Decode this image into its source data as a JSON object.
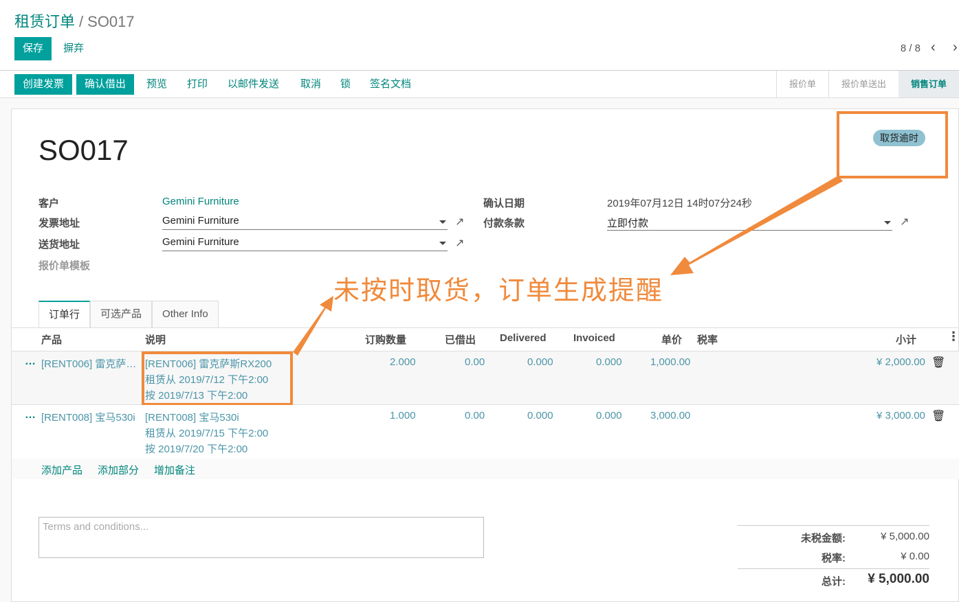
{
  "breadcrumb": {
    "parent": "租赁订单",
    "sep": "/",
    "current": "SO017"
  },
  "actions": {
    "save": "保存",
    "discard": "摒弃"
  },
  "pager": {
    "text": "8 / 8"
  },
  "toolbar": {
    "create_invoice": "创建发票",
    "confirm_checkout": "确认借出",
    "preview": "预览",
    "print": "打印",
    "send_email": "以邮件发送",
    "cancel": "取消",
    "lock": "锁",
    "sign_doc": "签名文档"
  },
  "stages": [
    {
      "label": "报价单"
    },
    {
      "label": "报价单送出"
    },
    {
      "label": "销售订单"
    }
  ],
  "order": {
    "name": "SO017",
    "badge": "取货逾时"
  },
  "fields": {
    "customer_label": "客户",
    "customer": "Gemini Furniture",
    "invoice_addr_label": "发票地址",
    "invoice_addr": "Gemini Furniture",
    "delivery_addr_label": "送货地址",
    "delivery_addr": "Gemini Furniture",
    "template_label": "报价单模板",
    "confirm_date_label": "确认日期",
    "confirm_date": "2019年07月12日 14时07分24秒",
    "payment_terms_label": "付款条款",
    "payment_terms": "立即付款"
  },
  "annotation": "未按时取货，订单生成提醒",
  "tabs": [
    {
      "label": "订单行"
    },
    {
      "label": "可选产品"
    },
    {
      "label": "Other Info"
    }
  ],
  "table": {
    "headers": {
      "product": "产品",
      "desc": "说明",
      "qty": "订购数量",
      "out": "已借出",
      "delivered": "Delivered",
      "invoiced": "Invoiced",
      "price": "单价",
      "tax": "税率",
      "subtotal": "小计"
    },
    "rows": [
      {
        "product": "[RENT006] 雷克萨…",
        "desc1": "[RENT006] 雷克萨斯RX200",
        "desc2": "租赁从 2019/7/12 下午2:00",
        "desc3": "按 2019/7/13 下午2:00",
        "qty": "2.000",
        "out": "0.00",
        "delivered": "0.000",
        "invoiced": "0.000",
        "price": "1,000.00",
        "subtotal": "¥ 2,000.00"
      },
      {
        "product": "[RENT008] 宝马530i",
        "desc1": "[RENT008] 宝马530i",
        "desc2": "租赁从 2019/7/15 下午2:00",
        "desc3": "按 2019/7/20 下午2:00",
        "qty": "1.000",
        "out": "0.00",
        "delivered": "0.000",
        "invoiced": "0.000",
        "price": "3,000.00",
        "subtotal": "¥ 3,000.00"
      }
    ],
    "add_product": "添加产品",
    "add_section": "添加部分",
    "add_note": "增加备注"
  },
  "terms": {
    "placeholder": "Terms and conditions..."
  },
  "totals": {
    "untaxed_label": "未税金额:",
    "untaxed": "¥ 5,000.00",
    "tax_label": "税率:",
    "tax": "¥ 0.00",
    "total_label": "总计:",
    "total": "¥ 5,000.00"
  },
  "colors": {
    "primary": "#00a09d",
    "link": "#00857c",
    "annotation": "#f08a3c"
  }
}
